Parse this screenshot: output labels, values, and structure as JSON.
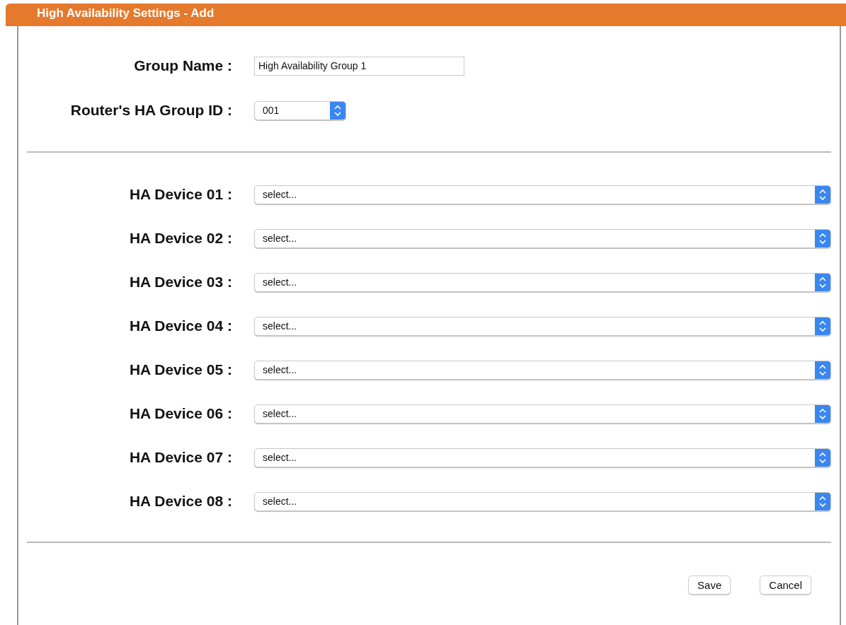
{
  "header": {
    "title": "High Availability Settings - Add"
  },
  "group_name": {
    "label": "Group Name :",
    "value": "High Availability Group 1"
  },
  "group_id": {
    "label": "Router's HA Group ID :",
    "value": "001"
  },
  "devices": [
    {
      "label": "HA Device 01 :",
      "value": "select..."
    },
    {
      "label": "HA Device 02 :",
      "value": "select..."
    },
    {
      "label": "HA Device 03 :",
      "value": "select..."
    },
    {
      "label": "HA Device 04 :",
      "value": "select..."
    },
    {
      "label": "HA Device 05 :",
      "value": "select..."
    },
    {
      "label": "HA Device 06 :",
      "value": "select..."
    },
    {
      "label": "HA Device 07 :",
      "value": "select..."
    },
    {
      "label": "HA Device 08 :",
      "value": "select..."
    }
  ],
  "buttons": [
    "Save",
    "Cancel"
  ]
}
